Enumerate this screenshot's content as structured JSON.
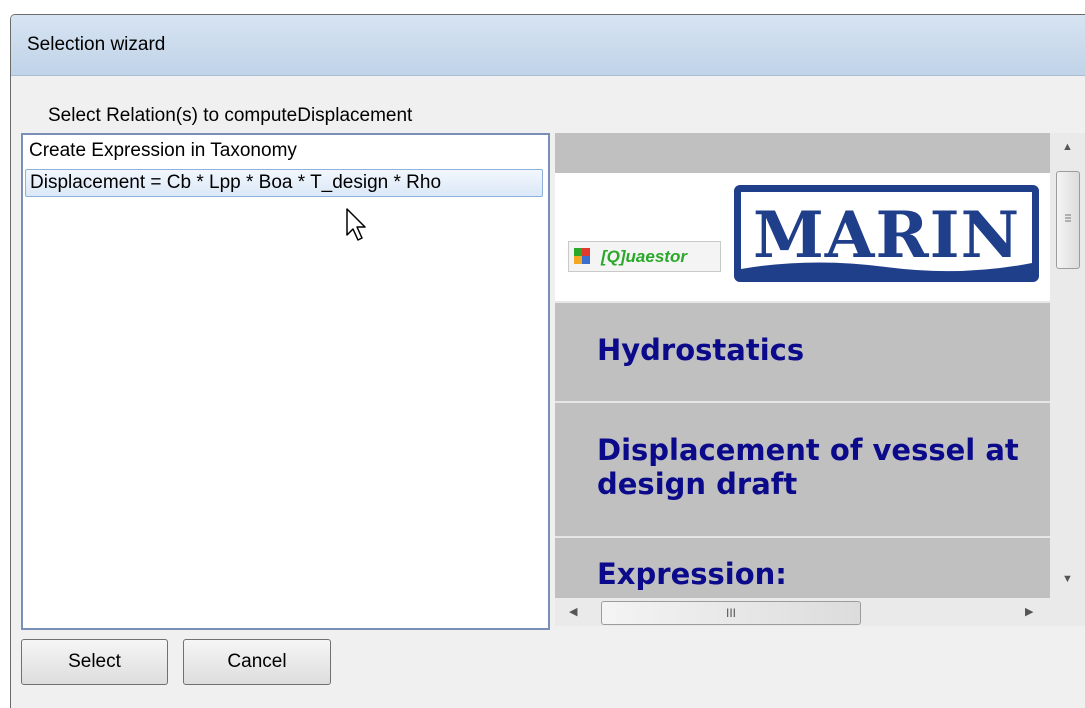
{
  "window": {
    "title": "Selection wizard"
  },
  "prompt": "Select Relation(s) to computeDisplacement",
  "list": {
    "items": [
      {
        "label": "Create Expression in Taxonomy",
        "selected": false
      },
      {
        "label": "Displacement = Cb * Lpp * Boa * T_design * Rho",
        "selected": true
      }
    ]
  },
  "preview": {
    "quaestor_logo_text": "[Q]uaestor",
    "marin_logo_text": "MARIN",
    "heading": "Hydrostatics",
    "description": "Displacement of vessel at design draft",
    "expression_label": "Expression:",
    "hscroll_grip": "III"
  },
  "buttons": {
    "select": "Select",
    "cancel": "Cancel"
  },
  "colors": {
    "heading_text": "#0a0a8a",
    "marin_blue": "#203f8b",
    "quaestor_green": "#2aa829"
  }
}
